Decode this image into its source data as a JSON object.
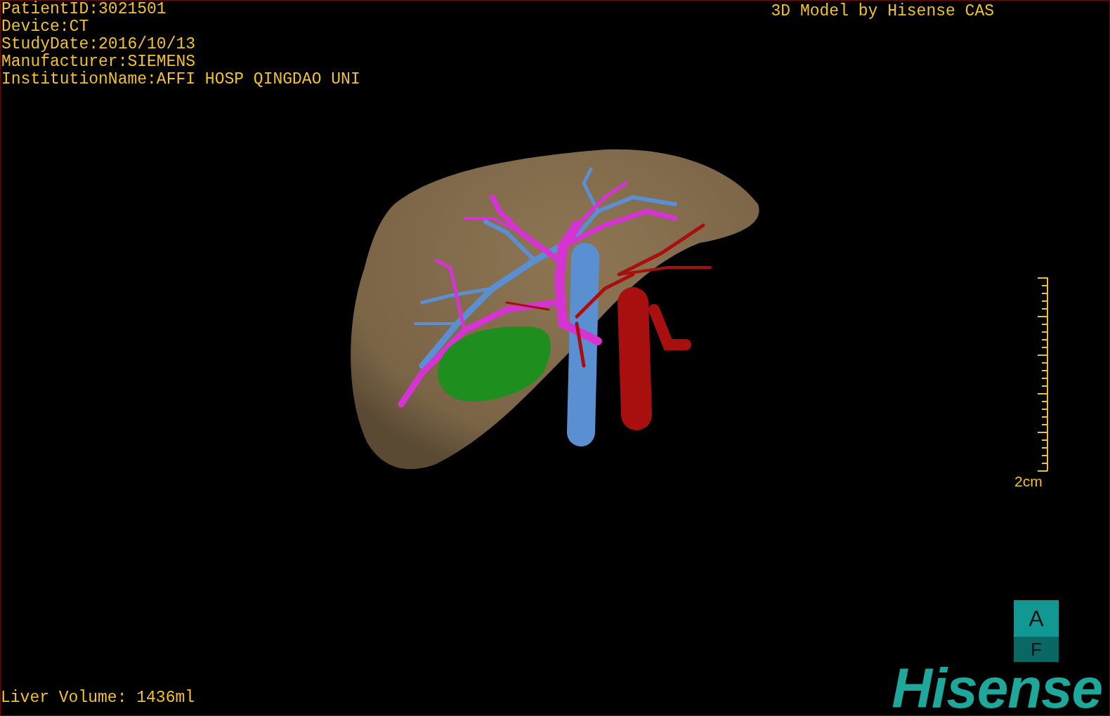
{
  "patient_info": [
    "PatientID:3021501",
    "Device:CT",
    "StudyDate:2016/10/13",
    "Manufacturer:SIEMENS",
    "InstitutionName:AFFI HOSP QINGDAO UNI"
  ],
  "credit": "3D Model by Hisense CAS",
  "scale_bar": {
    "label": "2cm"
  },
  "orientation_cube": {
    "top": "A",
    "bottom": "F"
  },
  "volume": "Liver Volume: 1436ml",
  "logo": "Hisense"
}
